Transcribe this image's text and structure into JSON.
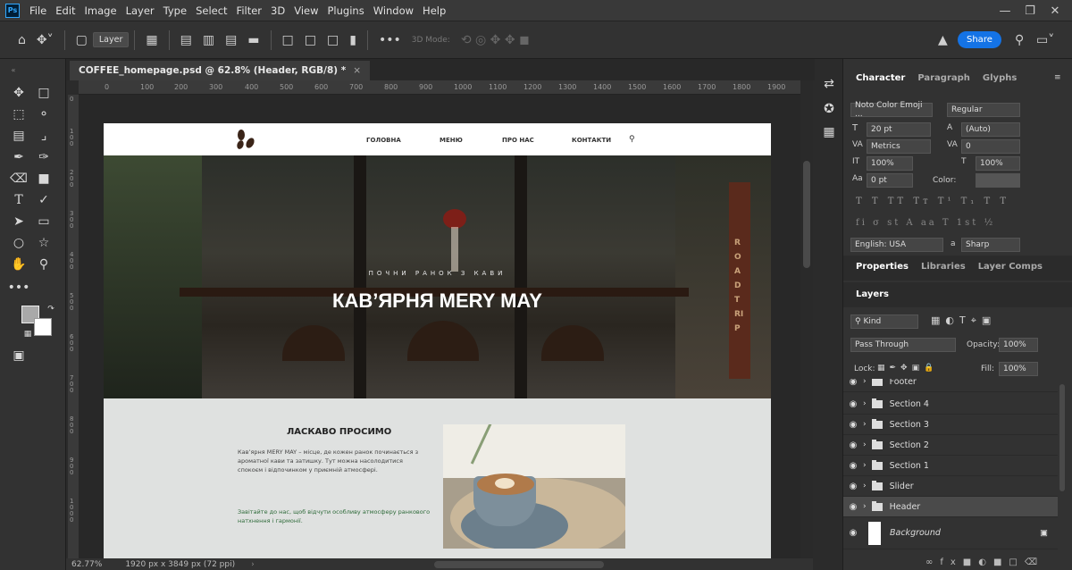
{
  "app": {
    "logo": "Ps"
  },
  "menubar": [
    "File",
    "Edit",
    "Image",
    "Layer",
    "Type",
    "Select",
    "Filter",
    "3D",
    "View",
    "Plugins",
    "Window",
    "Help"
  ],
  "optionsbar": {
    "layer_select": "Layer",
    "mode_label": "3D Mode:",
    "share": "Share"
  },
  "document": {
    "tab_title": "COFFEE_homepage.psd @ 62.8% (Header, RGB/8) *",
    "zoom": "62.77%",
    "size_info": "1920 px x 3849 px (72 ppi)",
    "ruler_h": [
      "0",
      "100",
      "200",
      "300",
      "400",
      "500",
      "600",
      "700",
      "800",
      "900",
      "1000",
      "1100",
      "1200",
      "1300",
      "1400",
      "1500",
      "1600",
      "1700",
      "1800",
      "1900"
    ],
    "ruler_v": [
      "0",
      "1 0 0",
      "2 0 0",
      "3 0 0",
      "4 0 0",
      "5 0 0",
      "6 0 0",
      "7 0 0",
      "8 0 0",
      "9 0 0",
      "1 0 0 0"
    ]
  },
  "site": {
    "nav": [
      "ГОЛОВНА",
      "МЕНЮ",
      "ПРО НАС",
      "КОНТАКТИ"
    ],
    "hero_subtitle": "ПОЧНИ РАНОК З КАВИ",
    "hero_title": "КАВ’ЯРНЯ MERY MAY",
    "hero_sign": "ROAD TRIP",
    "welcome_title": "ЛАСКАВО ПРОСИМО",
    "welcome_text": "Кав’ярня MERY MAY – місце, де кожен ранок починається з ароматної кави та затишку. Тут можна насолодитися спокоєм і відпочинком у приємній атмосфері.",
    "welcome_green": "Завітайте до нас, щоб відчути особливу атмосферу ранкового натхнення і гармонії."
  },
  "character": {
    "tabs": [
      "Character",
      "Paragraph",
      "Glyphs"
    ],
    "font_family": "Noto Color Emoji ...",
    "font_style": "Regular",
    "size": "20 pt",
    "leading": "(Auto)",
    "kerning": "Metrics",
    "tracking": "0",
    "vscale": "100%",
    "hscale": "100%",
    "baseline": "0 pt",
    "color_label": "Color:",
    "type_styles": "T T TT Tт T¹ T₁ T T",
    "opentype": "fi σ st A aa T 1st ½",
    "language": "English: USA",
    "aa_label": "a",
    "antialias": "Sharp"
  },
  "properties_tabs": [
    "Properties",
    "Libraries",
    "Layer Comps"
  ],
  "layers": {
    "title": "Layers",
    "kind": "Kind",
    "blend_mode": "Pass Through",
    "opacity_label": "Opacity:",
    "opacity": "100%",
    "lock_label": "Lock:",
    "fill_label": "Fill:",
    "fill": "100%",
    "items": [
      {
        "name": "Footer"
      },
      {
        "name": "Section 4"
      },
      {
        "name": "Section 3"
      },
      {
        "name": "Section 2"
      },
      {
        "name": "Section 1"
      },
      {
        "name": "Slider"
      },
      {
        "name": "Header"
      },
      {
        "name": "Background"
      }
    ]
  }
}
